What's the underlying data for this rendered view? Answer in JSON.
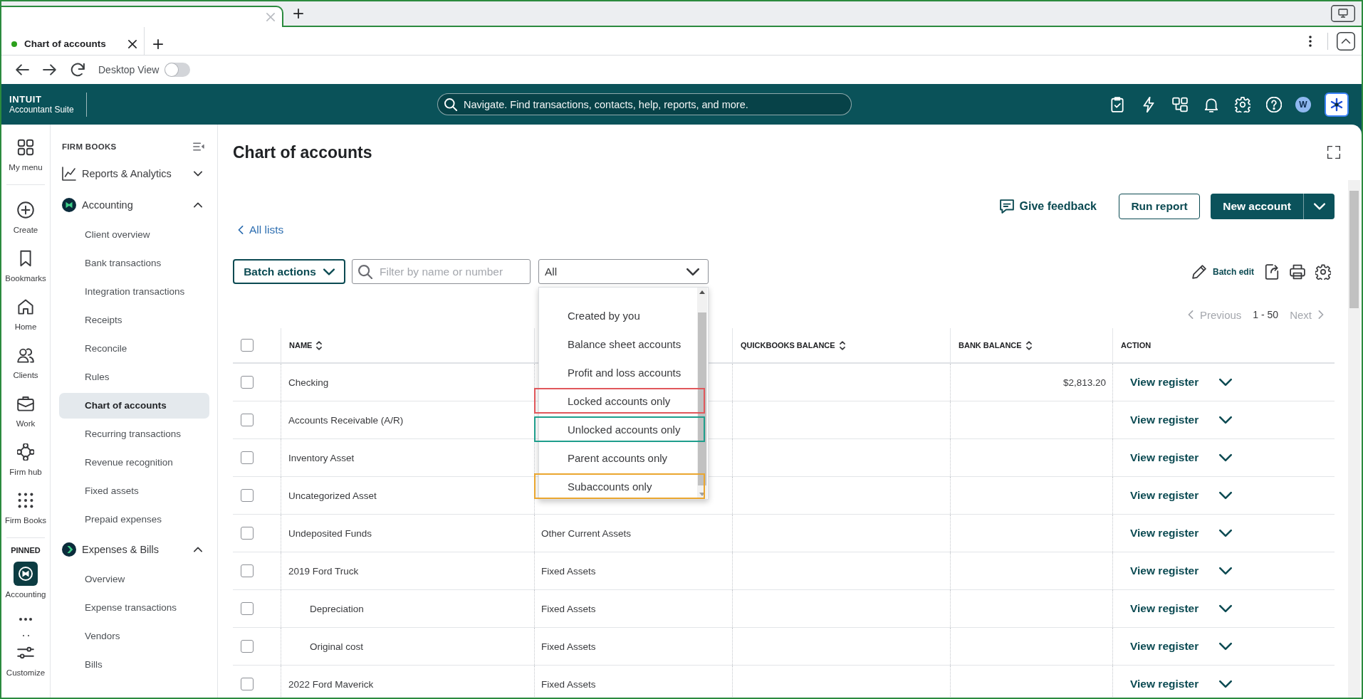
{
  "browser": {
    "tab": {
      "title": "Chart of accounts"
    },
    "desktop_view": {
      "label": "Desktop View",
      "on": false
    }
  },
  "header": {
    "brand": "INTUIT",
    "product": "Accountant Suite",
    "search": {
      "placeholder": "Navigate. Find transactions, contacts, help, reports, and more."
    },
    "avatar": "W"
  },
  "rail": {
    "items": [
      {
        "label": "My menu"
      },
      {
        "label": "Create"
      },
      {
        "label": "Bookmarks"
      },
      {
        "label": "Home"
      },
      {
        "label": "Clients"
      },
      {
        "label": "Work"
      },
      {
        "label": "Firm hub"
      },
      {
        "label": "Firm Books"
      }
    ],
    "pinned_heading": "PINNED",
    "pinned": [
      {
        "label": "Accounting"
      }
    ],
    "customize": "Customize"
  },
  "sidebar": {
    "heading": "FIRM BOOKS",
    "sections": [
      {
        "label": "Reports & Analytics",
        "expanded": false
      },
      {
        "label": "Accounting",
        "expanded": true,
        "children": [
          {
            "label": "Client overview",
            "selected": false
          },
          {
            "label": "Bank transactions",
            "selected": false
          },
          {
            "label": "Integration transactions",
            "selected": false
          },
          {
            "label": "Receipts",
            "selected": false
          },
          {
            "label": "Reconcile",
            "selected": false
          },
          {
            "label": "Rules",
            "selected": false
          },
          {
            "label": "Chart of accounts",
            "selected": true
          },
          {
            "label": "Recurring transactions",
            "selected": false
          },
          {
            "label": "Revenue recognition",
            "selected": false
          },
          {
            "label": "Fixed assets",
            "selected": false
          },
          {
            "label": "Prepaid expenses",
            "selected": false
          }
        ]
      },
      {
        "label": "Expenses & Bills",
        "expanded": true,
        "children": [
          {
            "label": "Overview",
            "selected": false
          },
          {
            "label": "Expense transactions",
            "selected": false
          },
          {
            "label": "Vendors",
            "selected": false
          },
          {
            "label": "Bills",
            "selected": false
          }
        ]
      }
    ]
  },
  "page": {
    "title": "Chart of accounts",
    "feedback": "Give feedback",
    "run_report": "Run report",
    "new_account": "New account",
    "back_link": "All lists",
    "batch_actions": "Batch actions",
    "filter": {
      "placeholder": "Filter by name or number"
    },
    "type_select": {
      "value": "All",
      "expanded": true,
      "options": [
        {
          "label": "Created by you",
          "selected": false
        },
        {
          "label": "Balance sheet accounts",
          "selected": false
        },
        {
          "label": "Profit and loss accounts",
          "selected": false
        },
        {
          "label": "Locked accounts only",
          "selected": false,
          "color": "#e0575b"
        },
        {
          "label": "Unlocked accounts only",
          "selected": false,
          "color": "#1f9e8c"
        },
        {
          "label": "Parent accounts only",
          "selected": false
        },
        {
          "label": "Subaccounts only",
          "selected": false,
          "color": "#eaa62f"
        }
      ]
    },
    "batch_edit": "Batch edit",
    "pagination": {
      "previous": "Previous",
      "previous_disabled": true,
      "range": "1 - 50",
      "next": "Next",
      "next_disabled": true
    }
  },
  "table": {
    "all_checked": false,
    "columns": [
      {
        "label": "NAME",
        "sortable": true
      },
      {
        "label": "QUICKBOOKS BALANCE",
        "sortable": true
      },
      {
        "label": "BANK BALANCE",
        "sortable": true
      },
      {
        "label": "ACTION",
        "sortable": false
      }
    ],
    "rows": [
      {
        "checked": false,
        "name": "Checking",
        "bank_balance": "$2,813.20",
        "action": "View register"
      },
      {
        "checked": false,
        "name": "Accounts Receivable (A/R)",
        "action": "View register"
      },
      {
        "checked": false,
        "name": "Inventory Asset",
        "action": "View register"
      },
      {
        "checked": false,
        "name": "Uncategorized Asset",
        "action": "View register"
      },
      {
        "checked": false,
        "name": "Undeposited Funds",
        "column_3": "Other Current Assets",
        "action": "View register"
      },
      {
        "checked": false,
        "name": "2019 Ford Truck",
        "column_3": "Fixed Assets",
        "action": "View register",
        "children": [
          {
            "checked": false,
            "name": "Depreciation",
            "column_3": "Fixed Assets",
            "action": "View register"
          },
          {
            "checked": false,
            "name": "Original cost",
            "column_3": "Fixed Assets",
            "action": "View register"
          }
        ]
      },
      {
        "checked": false,
        "name": "2022 Ford Maverick",
        "column_3": "Fixed Assets",
        "action": "View register"
      }
    ]
  }
}
